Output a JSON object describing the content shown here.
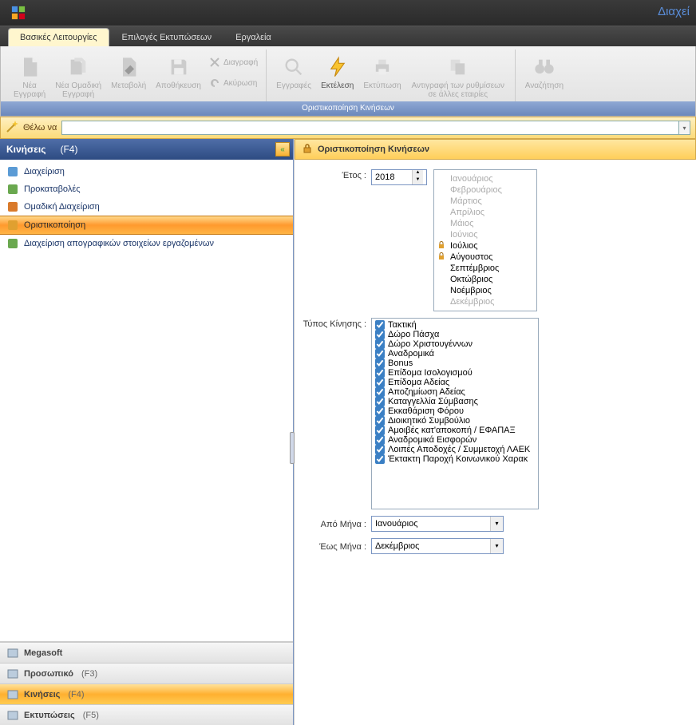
{
  "window": {
    "title": "Διαχεί"
  },
  "menu": {
    "tabs": [
      "Βασικές Λειτουργίες",
      "Επιλογές Εκτυπώσεων",
      "Εργαλεία"
    ],
    "active": 0
  },
  "ribbon": {
    "buttons": {
      "new_record": "Νέα\nΕγγραφή",
      "new_group_record": "Νέα Ομαδική\nΕγγραφή",
      "edit": "Μεταβολή",
      "save": "Αποθήκευση",
      "delete": "Διαγραφή",
      "cancel": "Ακύρωση",
      "records": "Εγγραφές",
      "execute": "Εκτέλεση",
      "print": "Εκτύπωση",
      "copy_settings": "Αντιγραφή των ρυθμίσεων\nσε άλλες εταιρίες",
      "search": "Αναζήτηση"
    },
    "footer": "Οριστικοποίηση Κινήσεων"
  },
  "searchbar": {
    "label": "Θέλω να",
    "value": ""
  },
  "sidebar": {
    "title": "Κινήσεις",
    "shortcut": "(F4)",
    "items": [
      {
        "label": "Διαχείριση"
      },
      {
        "label": "Προκαταβολές"
      },
      {
        "label": "Ομαδική Διαχείριση"
      },
      {
        "label": "Οριστικοποίηση"
      },
      {
        "label": "Διαχείριση απογραφικών στοιχείων εργαζομένων"
      }
    ],
    "selected": 3,
    "nav": [
      {
        "label": "Megasoft",
        "shortcut": ""
      },
      {
        "label": "Προσωπικό",
        "shortcut": "(F3)"
      },
      {
        "label": "Κινήσεις",
        "shortcut": "(F4)"
      },
      {
        "label": "Εκτυπώσεις",
        "shortcut": "(F5)"
      }
    ],
    "nav_active": 2
  },
  "main": {
    "title": "Οριστικοποίηση Κινήσεων",
    "year_label": "Έτος :",
    "year_value": "2018",
    "months": [
      {
        "name": "Ιανουάριος",
        "disabled": true,
        "locked": false
      },
      {
        "name": "Φεβρουάριος",
        "disabled": true,
        "locked": false
      },
      {
        "name": "Μάρτιος",
        "disabled": true,
        "locked": false
      },
      {
        "name": "Απρίλιος",
        "disabled": true,
        "locked": false
      },
      {
        "name": "Μάιος",
        "disabled": true,
        "locked": false
      },
      {
        "name": "Ιούνιος",
        "disabled": true,
        "locked": false
      },
      {
        "name": "Ιούλιος",
        "disabled": false,
        "locked": true
      },
      {
        "name": "Αύγουστος",
        "disabled": false,
        "locked": true
      },
      {
        "name": "Σεπτέμβριος",
        "disabled": false,
        "locked": false
      },
      {
        "name": "Οκτώβριος",
        "disabled": false,
        "locked": false
      },
      {
        "name": "Νοέμβριος",
        "disabled": false,
        "locked": false
      },
      {
        "name": "Δεκέμβριος",
        "disabled": true,
        "locked": false
      }
    ],
    "type_label": "Τύπος Κίνησης :",
    "types": [
      "Τακτική",
      "Δώρο Πάσχα",
      "Δώρο Χριστουγέννων",
      "Αναδρομικά",
      "Bonus",
      "Επίδομα Ισολογισμού",
      "Επίδομα Αδείας",
      "Αποζημίωση Αδείας",
      "Καταγγελλία Σύμβασης",
      "Εκκαθάριση Φόρου",
      "Διοικητικό Συμβούλιο",
      "Αμοιβές κατ'αποκοπή / ΕΦΑΠΑΞ",
      "Αναδρομικά Εισφορών",
      "Λοιπές Αποδοχές / Συμμετοχή ΛΑΕΚ",
      "Έκτακτη Παροχή Κοινωνικού Χαρακ"
    ],
    "from_month_label": "Από Μήνα :",
    "from_month_value": "Ιανουάριος",
    "to_month_label": "Έως Μήνα :",
    "to_month_value": "Δεκέμβριος"
  }
}
